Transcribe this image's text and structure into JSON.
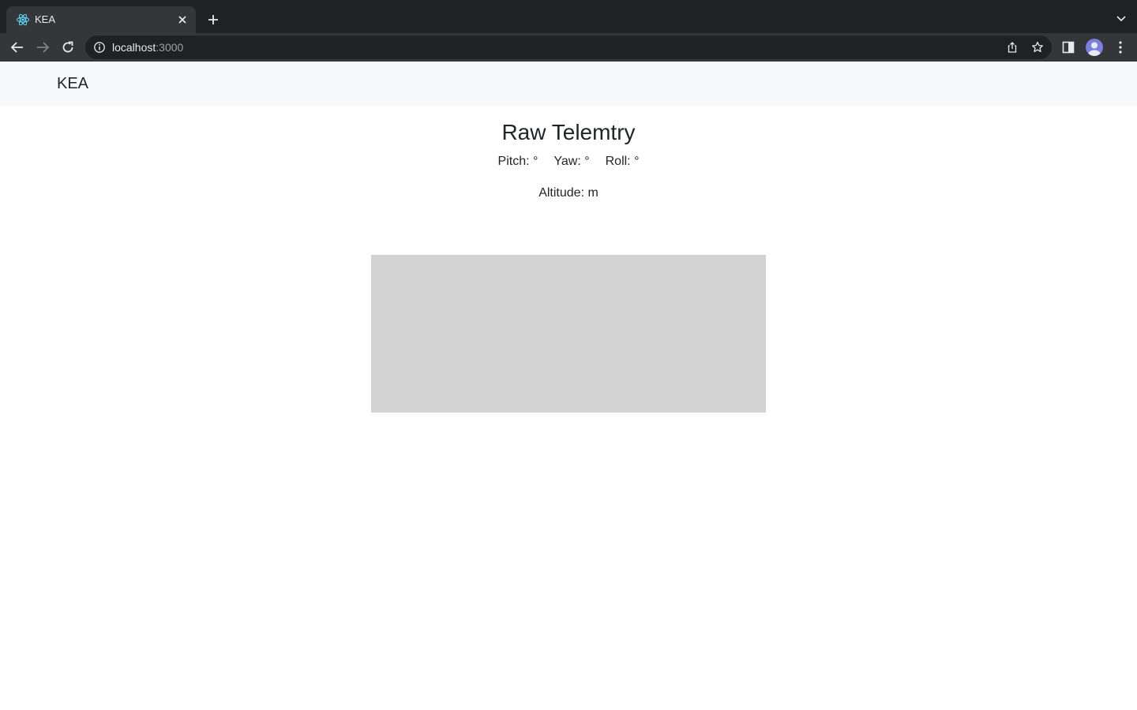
{
  "browser": {
    "tab": {
      "title": "KEA"
    },
    "omnibox": {
      "host": "localhost",
      "port": ":3000"
    }
  },
  "navbar": {
    "brand": "KEA"
  },
  "main": {
    "title": "Raw Telemtry",
    "pitch": "Pitch: °",
    "yaw": "Yaw: °",
    "roll": "Roll: °",
    "altitude": "Altitude: m"
  },
  "colors": {
    "chrome_dark": "#202124",
    "chrome_toolbar": "#35363a",
    "navbar_bg": "#f8f9fa",
    "canvas_bg": "#d3d3d3",
    "text": "#212529"
  }
}
